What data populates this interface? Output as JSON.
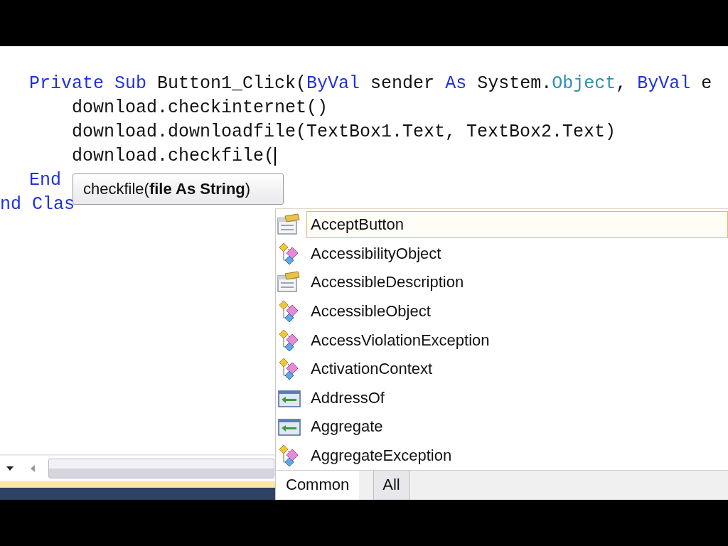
{
  "editor": {
    "body": [
      {
        "tokens": [
          {
            "kind": "keyword",
            "text": "Private Sub"
          },
          {
            "kind": "plain",
            "text": " Button1_Click("
          },
          {
            "kind": "keyword",
            "text": "ByVal"
          },
          {
            "kind": "plain",
            "text": " sender "
          },
          {
            "kind": "keyword",
            "text": "As"
          },
          {
            "kind": "plain",
            "text": " System."
          },
          {
            "kind": "type",
            "text": "Object"
          },
          {
            "kind": "plain",
            "text": ", "
          },
          {
            "kind": "keyword",
            "text": "ByVal"
          },
          {
            "kind": "plain",
            "text": " e"
          }
        ],
        "children": [
          {
            "tokens": [
              {
                "kind": "plain",
                "text": "download.checkinternet()"
              }
            ]
          },
          {
            "tokens": [
              {
                "kind": "plain",
                "text": "download.downloadfile(TextBox1.Text, TextBox2.Text)"
              }
            ]
          },
          {
            "tokens": [
              {
                "kind": "plain",
                "text": "download.checkfile("
              }
            ],
            "caret": true
          }
        ]
      },
      {
        "tokens": [
          {
            "kind": "keyword",
            "text": "End"
          }
        ]
      }
    ],
    "closing_line": {
      "tokens": [
        {
          "kind": "keyword",
          "text": "nd Clas"
        }
      ]
    }
  },
  "parameter_tooltip": {
    "text": "checkfile(**file As String**)"
  },
  "completion_list": {
    "items": [
      {
        "label": "AcceptButton",
        "kind": "property",
        "selected": true
      },
      {
        "label": "AccessibilityObject",
        "kind": "class",
        "selected": false
      },
      {
        "label": "AccessibleDescription",
        "kind": "property",
        "selected": false
      },
      {
        "label": "AccessibleObject",
        "kind": "class",
        "selected": false
      },
      {
        "label": "AccessViolationException",
        "kind": "class",
        "selected": false
      },
      {
        "label": "ActivationContext",
        "kind": "class",
        "selected": false
      },
      {
        "label": "AddressOf",
        "kind": "keyword",
        "selected": false
      },
      {
        "label": "Aggregate",
        "kind": "keyword",
        "selected": false
      },
      {
        "label": "AggregateException",
        "kind": "class",
        "selected": false
      }
    ],
    "tabs": [
      {
        "label": "Common",
        "selected": true
      },
      {
        "label": "All",
        "selected": false
      }
    ]
  }
}
